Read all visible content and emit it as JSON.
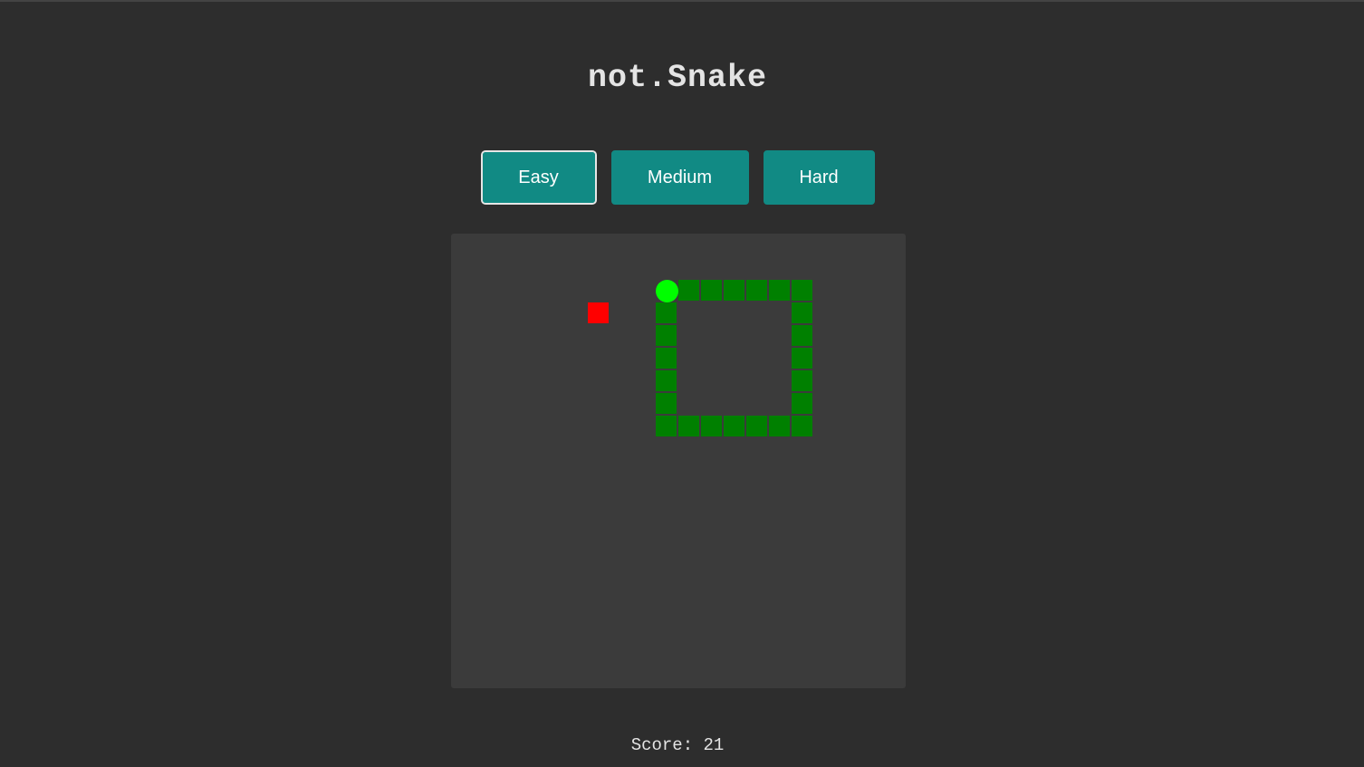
{
  "title": "not.Snake",
  "difficulty": {
    "selected": "Easy",
    "buttons": [
      {
        "label": "Easy"
      },
      {
        "label": "Medium"
      },
      {
        "label": "Hard"
      }
    ]
  },
  "score": {
    "text": "Score: 21"
  },
  "board": {
    "grid_cells": 20,
    "colors": {
      "background": "#3b3b3b",
      "snake_body": "#008000",
      "snake_head": "#00ff00",
      "food": "#ff0000"
    },
    "snake_head": [
      9,
      2
    ],
    "snake_body": [
      [
        10,
        2
      ],
      [
        11,
        2
      ],
      [
        12,
        2
      ],
      [
        13,
        2
      ],
      [
        14,
        2
      ],
      [
        15,
        2
      ],
      [
        15,
        3
      ],
      [
        15,
        4
      ],
      [
        15,
        5
      ],
      [
        15,
        6
      ],
      [
        15,
        7
      ],
      [
        15,
        8
      ],
      [
        14,
        8
      ],
      [
        13,
        8
      ],
      [
        12,
        8
      ],
      [
        11,
        8
      ],
      [
        10,
        8
      ],
      [
        9,
        8
      ],
      [
        9,
        7
      ],
      [
        9,
        6
      ],
      [
        9,
        5
      ],
      [
        9,
        4
      ],
      [
        9,
        3
      ]
    ],
    "food": [
      6,
      3
    ]
  }
}
